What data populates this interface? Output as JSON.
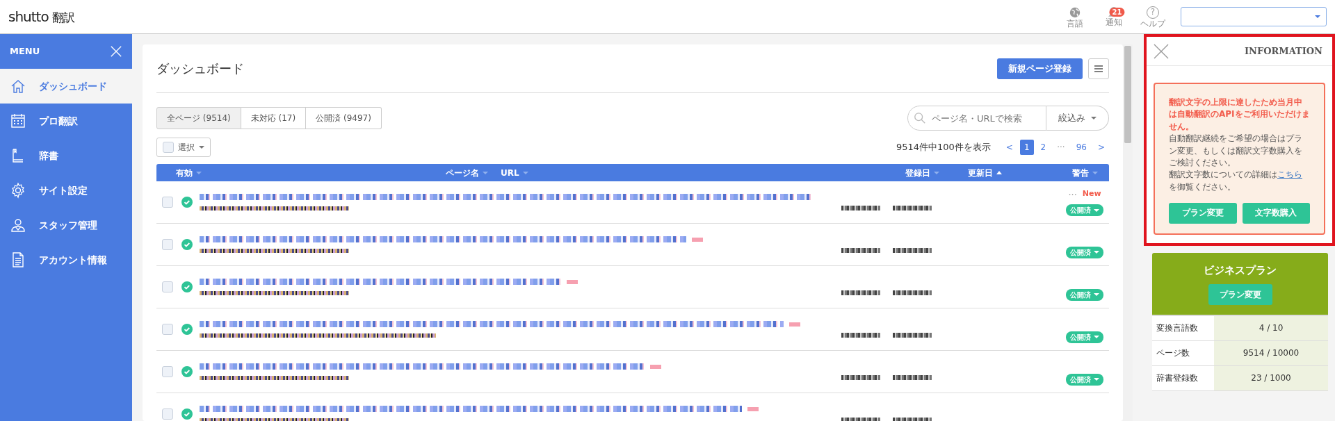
{
  "app": {
    "logo": "shutto",
    "logo_suffix": "翻訳"
  },
  "header_actions": [
    {
      "kind": "globe",
      "label": "言語"
    },
    {
      "kind": "bell",
      "label": "通知",
      "badge": "21"
    },
    {
      "kind": "help",
      "label": "ヘルプ",
      "glyph": "?"
    }
  ],
  "sidebar": {
    "title": "MENU",
    "items": [
      {
        "kind": "home",
        "label": "ダッシュボード",
        "selected": true
      },
      {
        "kind": "calendar",
        "label": "プロ翻訳",
        "selected": false
      },
      {
        "kind": "book",
        "label": "辞書",
        "selected": false
      },
      {
        "kind": "gear",
        "label": "サイト設定",
        "selected": false
      },
      {
        "kind": "people",
        "label": "スタッフ管理",
        "selected": false
      },
      {
        "kind": "document",
        "label": "アカウント情報",
        "selected": false
      }
    ]
  },
  "page": {
    "title": "ダッシュボード",
    "primary_button": "新規ページ登録"
  },
  "tabs": [
    {
      "label": "全ページ (9514)",
      "selected": true
    },
    {
      "label": "未対応 (17)",
      "selected": false
    },
    {
      "label": "公開済 (9497)",
      "selected": false
    }
  ],
  "search": {
    "placeholder": "ページ名・URLで検索"
  },
  "filter": "絞込み",
  "select_all": {
    "label": "選択",
    "checked": false
  },
  "count_text": "9514件中100件を表示",
  "pagination": [
    {
      "kind": "arrow",
      "label": "<",
      "selected": false
    },
    {
      "kind": "page",
      "label": "1",
      "selected": true
    },
    {
      "kind": "page",
      "label": "2",
      "selected": false
    },
    {
      "kind": "ellipsis",
      "label": "···",
      "selected": false
    },
    {
      "kind": "page",
      "label": "96",
      "selected": false
    },
    {
      "kind": "arrow",
      "label": ">",
      "selected": false
    }
  ],
  "table": {
    "columns": [
      {
        "label": "有効",
        "sorted": false
      },
      {
        "label": "ページ名",
        "sorted": false
      },
      {
        "label": "URL",
        "sorted": false
      },
      {
        "label": "登録日",
        "sorted": false
      },
      {
        "label": "更新日",
        "sorted": true
      },
      {
        "label": "警告",
        "sorted": false
      }
    ],
    "rows": [
      {
        "checked": false,
        "enabled": true,
        "status": "公開済",
        "warning_prefix": "···",
        "warning": "New"
      },
      {
        "checked": false,
        "enabled": true,
        "status": "公開済"
      },
      {
        "checked": false,
        "enabled": true,
        "status": "公開済"
      },
      {
        "checked": false,
        "enabled": true,
        "status": "公開済"
      },
      {
        "checked": false,
        "enabled": true,
        "status": "公開済"
      },
      {
        "checked": false,
        "enabled": true
      }
    ]
  },
  "info_panel": {
    "title": "INFORMATION",
    "highlighted": true,
    "alert": {
      "heading": "翻訳文字の上限に達したため当月中は自動翻訳のAPIをご利用いただけません。",
      "body": "自動翻訳継続をご希望の場合はプラン変更、もしくは翻訳文字数購入をご検討ください。",
      "detail_before": "翻訳文字数についての詳細は",
      "link": "こちら",
      "detail_after": "を御覧ください。",
      "buttons": [
        "プラン変更",
        "文字数購入"
      ]
    },
    "plan": {
      "name": "ビジネスプラン",
      "button": "プラン変更",
      "stats": [
        {
          "label": "変換言語数",
          "value": "4 / 10"
        },
        {
          "label": "ページ数",
          "value": "9514 / 10000"
        },
        {
          "label": "辞書登録数",
          "value": "23 / 1000"
        }
      ]
    }
  }
}
